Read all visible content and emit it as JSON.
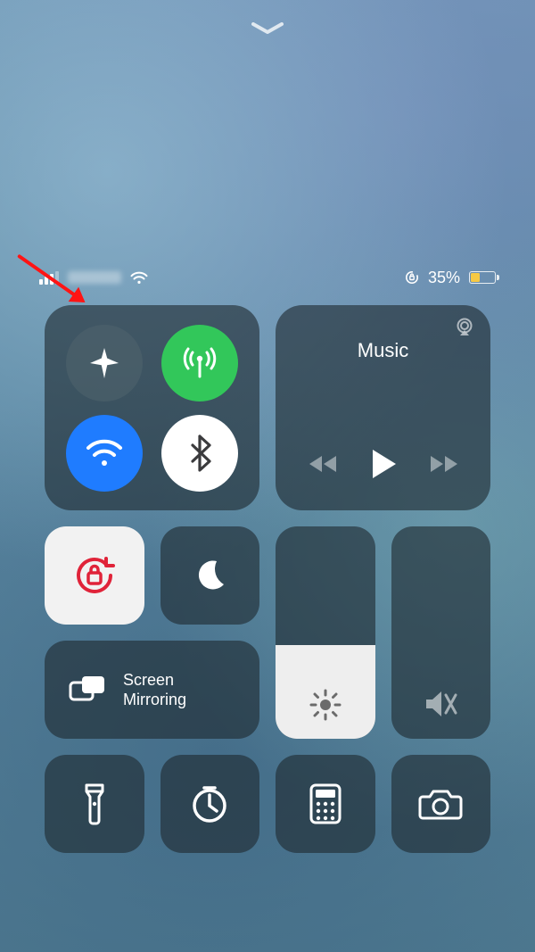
{
  "status": {
    "battery_percent": "35%",
    "orientation_lock_on": true,
    "wifi_on": true,
    "signal_bars": 3
  },
  "media": {
    "title": "Music"
  },
  "mirroring": {
    "label": "Screen\nMirroring"
  },
  "brightness": {
    "level_percent": 44
  },
  "toggles": {
    "airplane_on": false,
    "cellular_on": true,
    "wifi_on": true,
    "bluetooth_on": true,
    "orientation_lock_on": true,
    "dnd_on": false
  },
  "colors": {
    "panel": "rgba(30,42,48,.62)",
    "green": "#32c75a",
    "blue": "#1f7cff",
    "white": "#ffffff",
    "battery_low": "#f6c945",
    "annotation_arrow": "#ff1414"
  }
}
